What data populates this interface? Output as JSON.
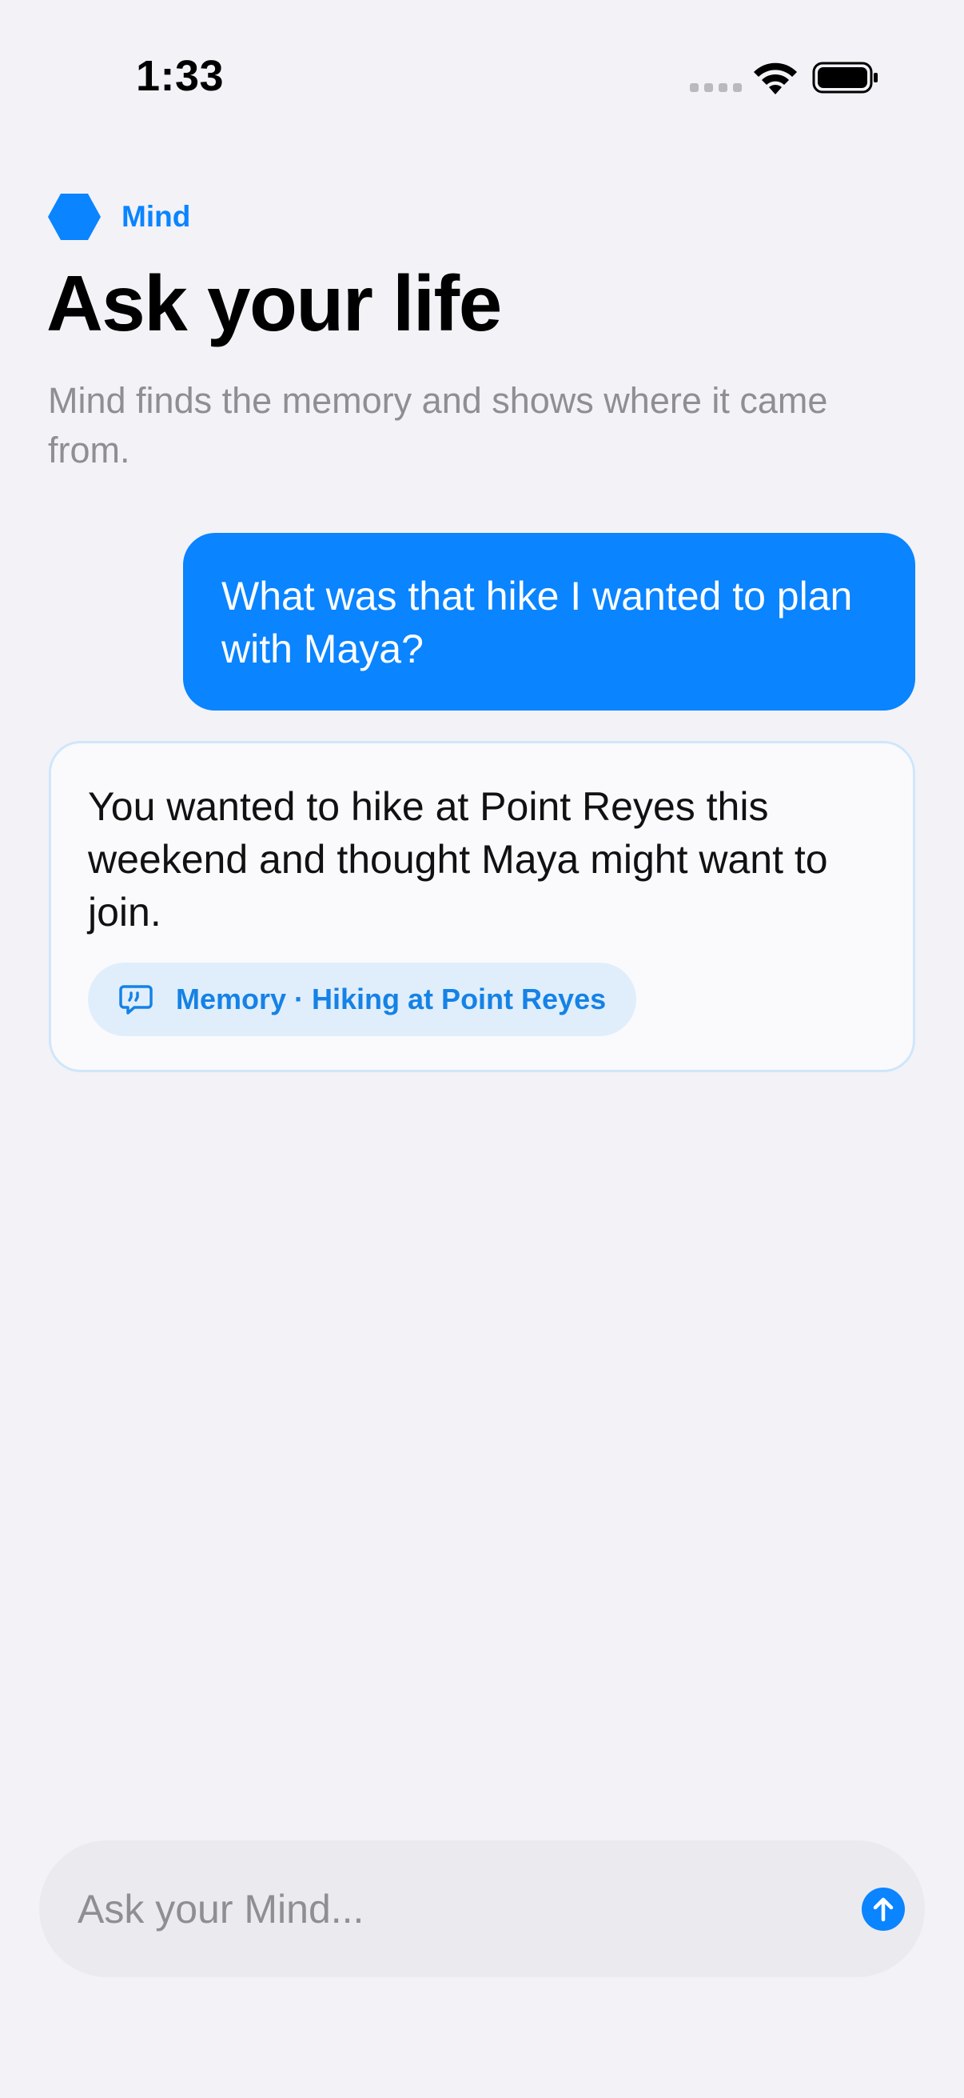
{
  "status_bar": {
    "time": "1:33",
    "icons": [
      "cellular-signal-icon",
      "wifi-icon",
      "battery-icon"
    ]
  },
  "header": {
    "app_icon": "hexagon-icon",
    "app_name": "Mind",
    "title": "Ask your life",
    "subtitle": "Mind finds the memory and shows where it came from."
  },
  "conversation": {
    "user_message": "What was that hike I wanted to plan with Maya?",
    "answer": {
      "text": "You wanted to hike at Point Reyes this weekend and thought Maya might want to join.",
      "source_icon": "quote-bubble-icon",
      "source_label": "Memory · Hiking at Point Reyes"
    }
  },
  "composer": {
    "placeholder": "Ask your Mind...",
    "value": "",
    "send_icon": "arrow-up-circle-icon"
  },
  "colors": {
    "accent": "#0A84FF",
    "background": "#F2F2F7",
    "secondary_text": "#8E8E93",
    "pill_background": "#E0EEFC"
  }
}
